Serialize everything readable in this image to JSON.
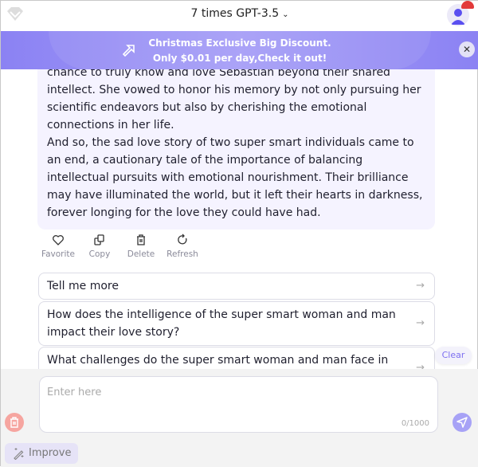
{
  "header": {
    "title": "7 times GPT-3.5",
    "icons": [
      "diamond-icon",
      "chevron-down-icon",
      "avatar-icon"
    ]
  },
  "banner": {
    "line1": "Christmas Exclusive Big Discount.",
    "line2": "Only $0.01 per day,Check it out!",
    "color": "#8b82f3"
  },
  "message": {
    "paragraphs": [
      "chance to truly know and love Sebastian beyond their shared intellect. She vowed to honor his memory by not only pursuing her scientific endeavors but also by cherishing the emotional connections in her life.",
      "And so, the sad love story of two super smart individuals came to an end, a cautionary tale of the importance of balancing intellectual pursuits with emotional nourishment. Their brilliance may have illuminated the world, but it left their hearts in darkness, forever longing for the love they could have had."
    ]
  },
  "actions": [
    {
      "label": "Favorite",
      "icon": "heart-icon"
    },
    {
      "label": "Copy",
      "icon": "copy-icon"
    },
    {
      "label": "Delete",
      "icon": "trash-icon"
    },
    {
      "label": "Refresh",
      "icon": "refresh-icon"
    }
  ],
  "suggestions": [
    "Tell me more",
    "How does the intelligence of the super smart woman and man impact their love story?",
    "What challenges do the super smart woman and man face in"
  ],
  "clear_label": "Clear",
  "input": {
    "placeholder": "Enter here",
    "value": "",
    "count": "0/1000"
  },
  "improve_label": "Improve",
  "accent": "#7d6ff0"
}
